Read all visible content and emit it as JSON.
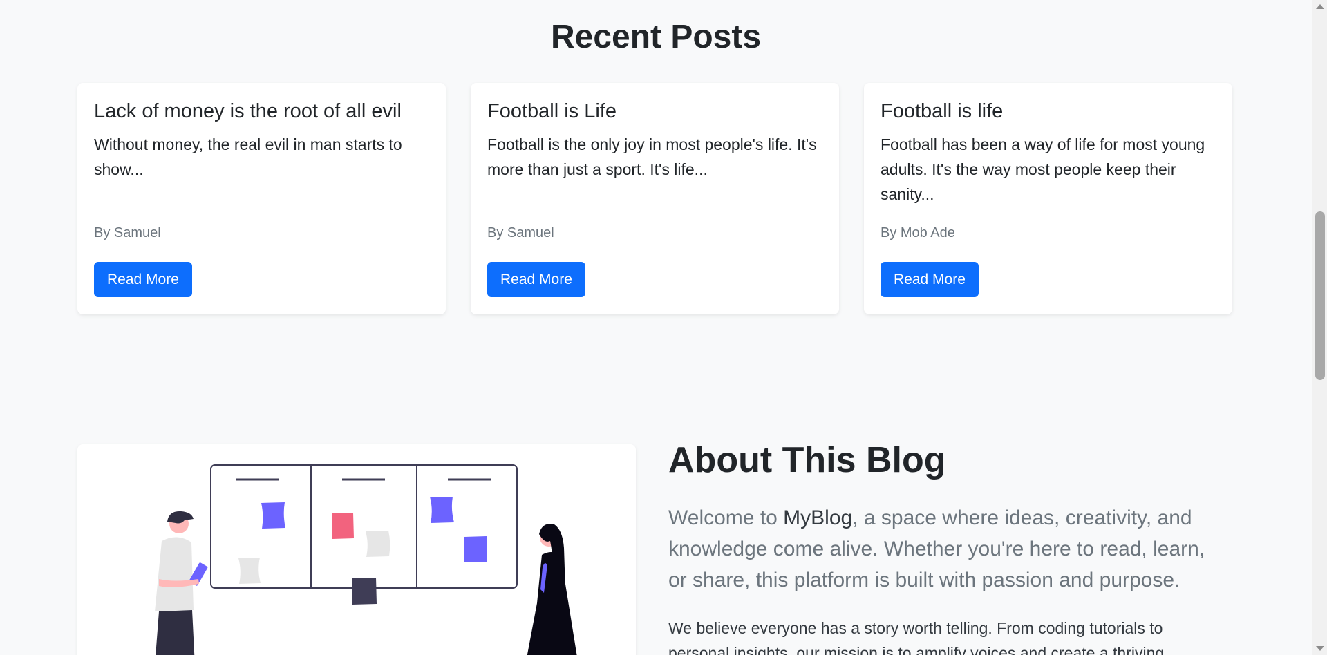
{
  "recent_posts": {
    "title": "Recent Posts",
    "posts": [
      {
        "title": "Lack of money is the root of all evil",
        "excerpt": "Without money, the real evil in man starts to show...",
        "author": "By Samuel",
        "button_label": "Read More"
      },
      {
        "title": "Football is Life",
        "excerpt": "Football is the only joy in most people's life. It's more than just a sport. It's life...",
        "author": "By Samuel",
        "button_label": "Read More"
      },
      {
        "title": "Football is life",
        "excerpt": "Football has been a way of life for most young adults. It's the way most people keep their sanity...",
        "author": "By Mob Ade",
        "button_label": "Read More"
      }
    ]
  },
  "about": {
    "title": "About This Blog",
    "lead_prefix": "Welcome to ",
    "brand": "MyBlog",
    "lead_suffix": ", a space where ideas, creativity, and knowledge come alive. Whether you're here to read, learn, or share, this platform is built with passion and purpose.",
    "body": "We believe everyone has a story worth telling. From coding tutorials to personal insights, our mission is to amplify voices and create a thriving"
  },
  "colors": {
    "page_background": "#f8f9fa",
    "button_primary": "#0d6efd",
    "illustration_accent": "#6c63ff",
    "illustration_pink": "#f2637e",
    "illustration_dark": "#3f3d56"
  },
  "icons": {
    "scroll_up": "triangle-up-icon",
    "scroll_down": "triangle-down-icon"
  }
}
